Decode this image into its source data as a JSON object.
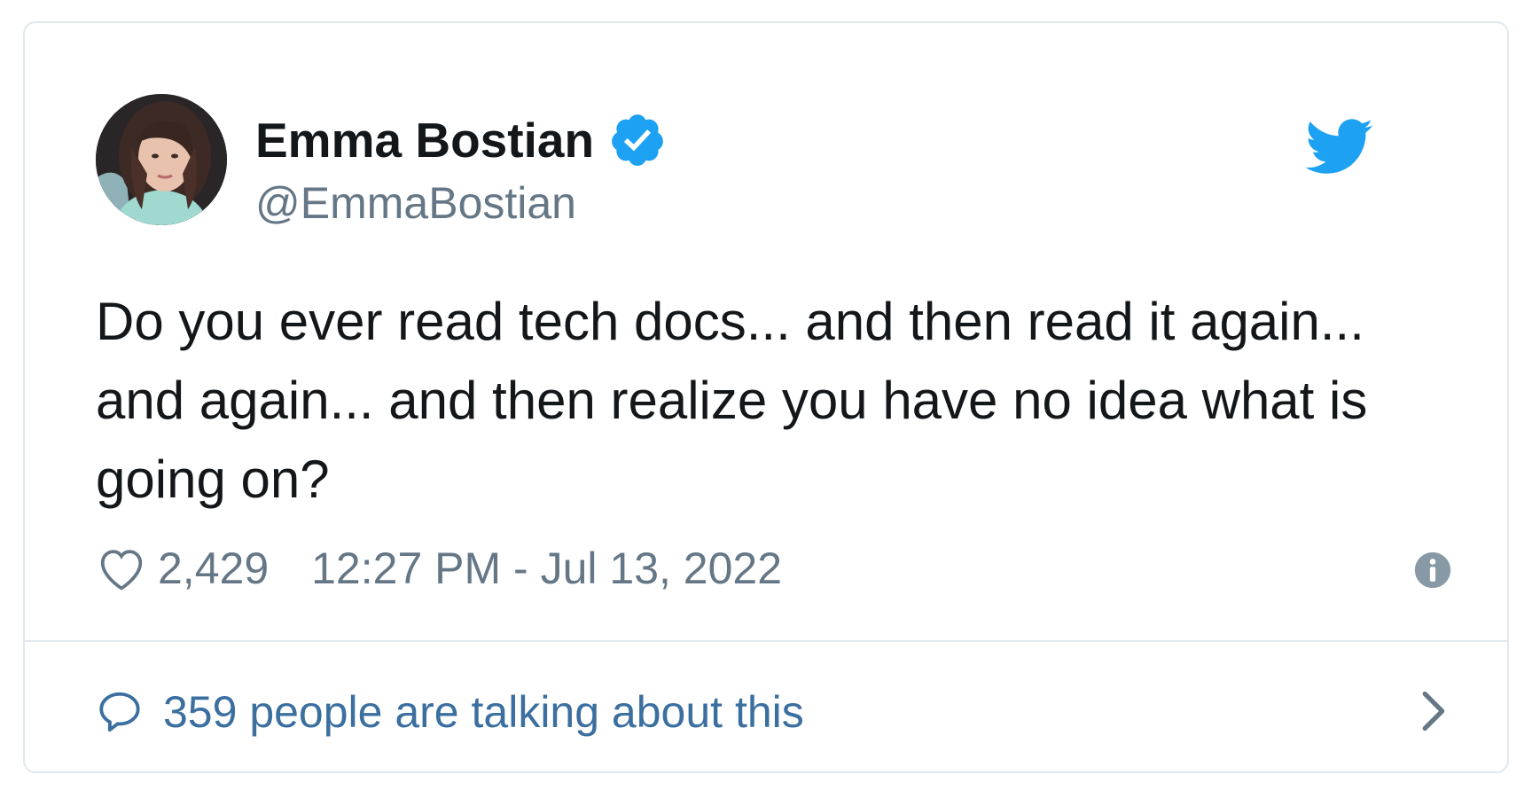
{
  "tweet": {
    "author": {
      "display_name": "Emma Bostian",
      "handle": "@EmmaBostian",
      "verified": true
    },
    "text": "Do you ever read tech docs... and then read it again... and again... and then realize you have no idea what is going on?",
    "likes": "2,429",
    "timestamp": "12:27 PM - Jul 13, 2022",
    "conversation_label": "359 people are talking about this"
  },
  "icons": {
    "brand": "twitter-bird-icon",
    "verified": "verified-badge-icon",
    "like": "heart-icon",
    "info": "info-icon",
    "reply": "speech-bubble-icon",
    "chevron": "chevron-right-icon"
  },
  "colors": {
    "twitter_blue": "#1da1f2",
    "text_primary": "#14171a",
    "text_secondary": "#657786",
    "link_blue": "#3b6f9f",
    "border": "#e1e8ed"
  }
}
